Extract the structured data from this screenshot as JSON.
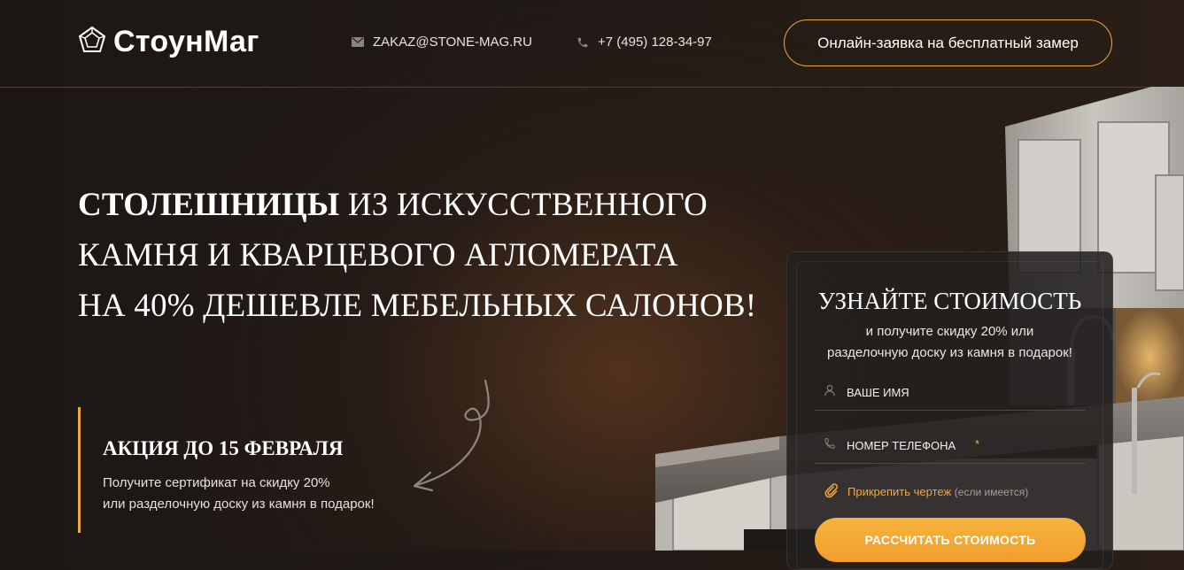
{
  "header": {
    "logo_text": "СтоунМаг",
    "email": "ZAKAZ@STONE-MAG.RU",
    "phone": "+7 (495) 128-34-97",
    "cta_label": "Онлайн-заявка на бесплатный замер"
  },
  "hero": {
    "title_strong": "СТОЛЕШНИЦЫ",
    "title_line1_rest": " ИЗ ИСКУССТВЕННОГО",
    "title_line2": "КАМНЯ И КВАРЦЕВОГО АГЛОМЕРАТА",
    "title_line3": "НА 40% ДЕШЕВЛЕ МЕБЕЛЬНЫХ САЛОНОВ!"
  },
  "promo": {
    "title": "АКЦИЯ ДО 15 ФЕВРАЛЯ",
    "line1": "Получите сертификат на скидку 20%",
    "line2": "или разделочную доску из камня в подарок!"
  },
  "form": {
    "title": "УЗНАЙТЕ СТОИМОСТЬ",
    "subtitle_line1": "и получите скидку 20% или",
    "subtitle_line2": "разделочную доску из камня в подарок!",
    "name_placeholder": "ВАШЕ ИМЯ",
    "phone_placeholder": "НОМЕР ТЕЛЕФОНА",
    "phone_required_mark": "*",
    "attach_label": "Прикрепить чертеж",
    "attach_note": "(если имеется)",
    "submit_label": "РАССЧИТАТЬ СТОИМОСТЬ"
  },
  "colors": {
    "accent": "#f0a73b",
    "background": "#1c1715",
    "text": "#ffffff"
  },
  "icons": {
    "logo": "pentagon-logo-icon",
    "email": "envelope-icon",
    "phone": "phone-icon",
    "name_field": "user-icon",
    "phone_field": "phone-icon",
    "attach": "paperclip-icon",
    "promo_arrow": "curved-arrow-icon"
  }
}
